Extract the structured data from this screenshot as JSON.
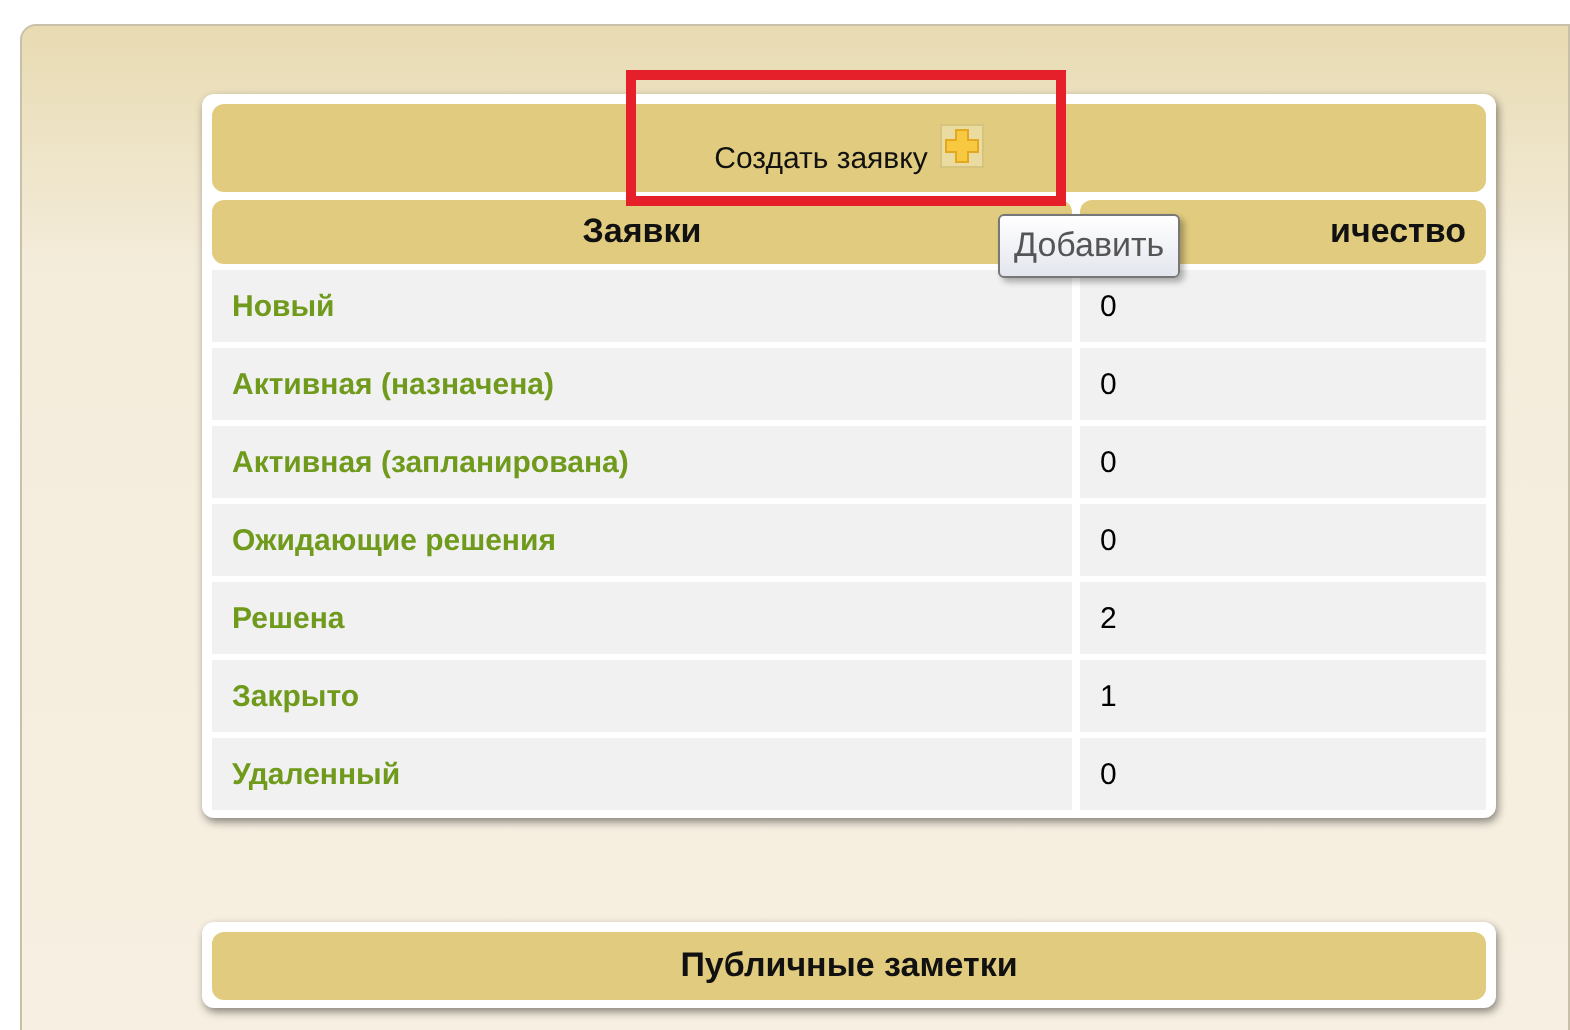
{
  "tickets_panel": {
    "title": "Создать заявку",
    "columns": [
      "Заявки",
      "ичество"
    ],
    "tooltip": "Добавить",
    "rows": [
      {
        "status": "Новый",
        "count": "0"
      },
      {
        "status": "Активная (назначена)",
        "count": "0"
      },
      {
        "status": "Активная (запланирована)",
        "count": "0"
      },
      {
        "status": "Ожидающие решения",
        "count": "0"
      },
      {
        "status": "Решена",
        "count": "2"
      },
      {
        "status": "Закрыто",
        "count": "1"
      },
      {
        "status": "Удаленный",
        "count": "0"
      }
    ]
  },
  "notes_panel": {
    "title": "Публичные заметки"
  }
}
